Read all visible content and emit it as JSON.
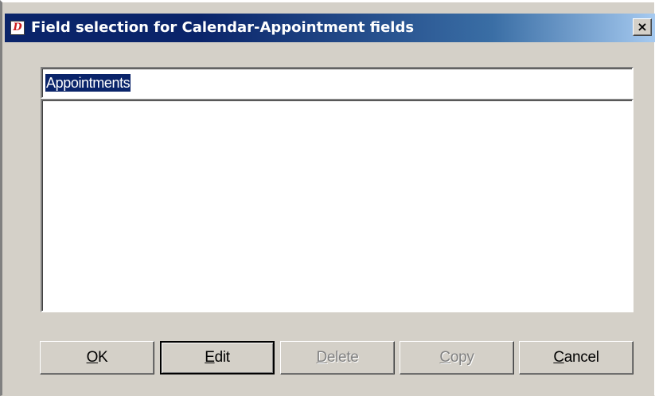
{
  "window": {
    "title": "Field selection for Calendar-Appointment fields",
    "icon_letter": "D",
    "close_glyph": "×"
  },
  "name_field": {
    "value": "Appointments"
  },
  "list": {
    "items": []
  },
  "buttons": {
    "ok": {
      "mnemonic": "O",
      "rest": "K",
      "enabled": true
    },
    "edit": {
      "mnemonic": "E",
      "rest": "dit",
      "enabled": true,
      "default": true
    },
    "delete": {
      "mnemonic": "D",
      "rest": "elete",
      "enabled": false
    },
    "copy": {
      "mnemonic": "C",
      "rest": "opy",
      "enabled": false
    },
    "cancel": {
      "mnemonic": "C",
      "rest": "ancel",
      "enabled": true
    }
  },
  "colors": {
    "titlebar_start": "#0a246a",
    "titlebar_end": "#a6caf0",
    "face": "#d4d0c8",
    "selection": "#0a246a",
    "disabled_text": "#808080"
  },
  "icons": {
    "app": "app-logo-icon",
    "close": "close-icon"
  }
}
